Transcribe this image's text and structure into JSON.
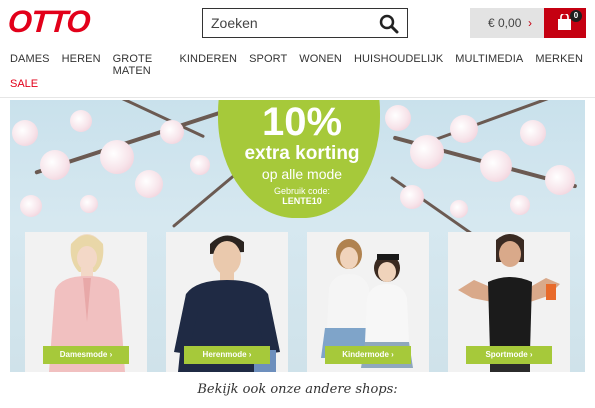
{
  "header": {
    "logo": "OTTO",
    "search_placeholder": "Zoeken",
    "cart_amount": "€ 0,00",
    "cart_chevron": "›",
    "cart_count": "0"
  },
  "nav": {
    "items": [
      {
        "label": "DAMES"
      },
      {
        "label": "HEREN"
      },
      {
        "label": "GROTE MATEN"
      },
      {
        "label": "KINDEREN"
      },
      {
        "label": "SPORT"
      },
      {
        "label": "WONEN"
      },
      {
        "label": "HUISHOUDELIJK"
      },
      {
        "label": "MULTIMEDIA"
      },
      {
        "label": "MERKEN"
      }
    ],
    "sale": "SALE"
  },
  "promo": {
    "percent": "10%",
    "line1": "extra korting",
    "line2": "op alle mode",
    "code_label": "Gebruik code:",
    "code": "LENTE10"
  },
  "tiles": [
    {
      "button": "Damesmode ›"
    },
    {
      "button": "Herenmode ›"
    },
    {
      "button": "Kindermode ›"
    },
    {
      "button": "Sportmode ›"
    }
  ],
  "footer": {
    "text": "Bekijk ook onze andere shops:"
  },
  "colors": {
    "brand_red": "#e2001a",
    "accent_green": "#a6c93a"
  }
}
